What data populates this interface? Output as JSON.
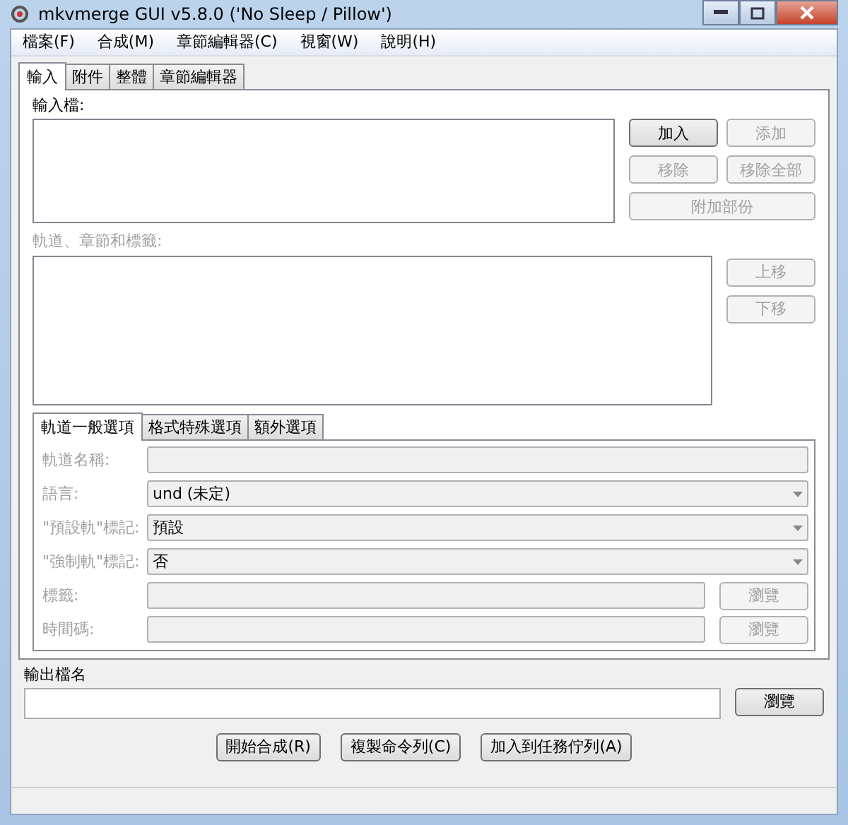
{
  "window": {
    "title": "mkvmerge GUI v5.8.0 ('No Sleep / Pillow')"
  },
  "menu": [
    "檔案(F)",
    "合成(M)",
    "章節編輯器(C)",
    "視窗(W)",
    "說明(H)"
  ],
  "tabs": [
    {
      "label": "輸入",
      "selected": true
    },
    {
      "label": "附件",
      "selected": false
    },
    {
      "label": "整體",
      "selected": false
    },
    {
      "label": "章節編輯器",
      "selected": false
    }
  ],
  "input": {
    "files_label": "輸入檔:",
    "file_buttons": [
      {
        "label": "加入",
        "disabled": false
      },
      {
        "label": "添加",
        "disabled": true
      },
      {
        "label": "移除",
        "disabled": true
      },
      {
        "label": "移除全部",
        "disabled": true
      },
      {
        "label": "附加部份",
        "disabled": true
      }
    ],
    "tracks_label": "軌道、章節和標籤:",
    "tracks_disabled": true,
    "track_buttons": [
      {
        "label": "上移",
        "disabled": true
      },
      {
        "label": "下移",
        "disabled": true
      }
    ]
  },
  "track_tabs": [
    {
      "label": "軌道一般選項",
      "selected": true
    },
    {
      "label": "格式特殊選項",
      "selected": false
    },
    {
      "label": "額外選項",
      "selected": false
    }
  ],
  "track_options": [
    {
      "kind": "text",
      "label": "軌道名稱:",
      "disabled": true
    },
    {
      "kind": "select",
      "label": "語言:",
      "value": "und (未定)",
      "disabled": true
    },
    {
      "kind": "select",
      "label": "\"預設軌\"標記:",
      "value": "預設",
      "disabled": true
    },
    {
      "kind": "select",
      "label": "\"強制軌\"標記:",
      "value": "否",
      "disabled": true
    },
    {
      "kind": "browse",
      "label": "標籤:",
      "button": "瀏覽",
      "disabled": true
    },
    {
      "kind": "browse",
      "label": "時間碼:",
      "button": "瀏覽",
      "disabled": true
    }
  ],
  "output": {
    "label": "輸出檔名",
    "button": "瀏覽"
  },
  "actions": [
    "開始合成(R)",
    "複製命令列(C)",
    "加入到任務佇列(A)"
  ]
}
